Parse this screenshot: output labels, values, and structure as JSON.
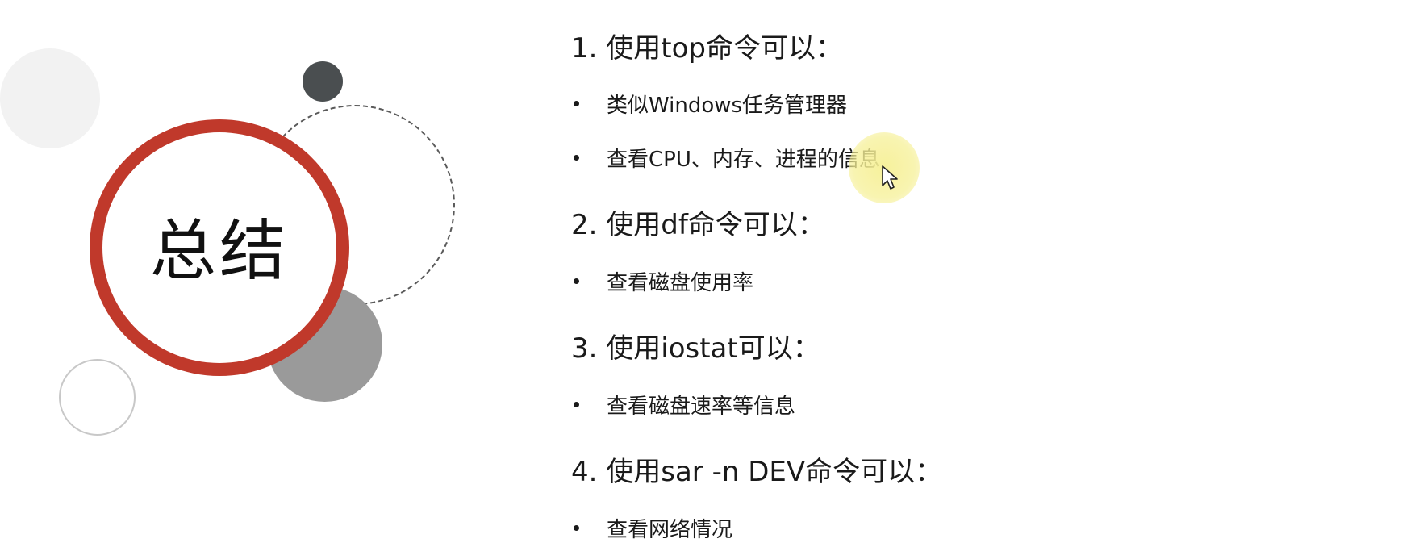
{
  "slide": {
    "title": "总结",
    "sections": [
      {
        "heading": "1. 使用top命令可以：",
        "bullets": [
          "类似Windows任务管理器",
          "查看CPU、内存、进程的信息"
        ]
      },
      {
        "heading": "2. 使用df命令可以：",
        "bullets": [
          "查看磁盘使用率"
        ]
      },
      {
        "heading": "3. 使用iostat可以：",
        "bullets": [
          "查看磁盘速率等信息"
        ]
      },
      {
        "heading": "4. 使用sar -n DEV命令可以：",
        "bullets": [
          "查看网络情况"
        ]
      }
    ]
  },
  "colors": {
    "accent_red": "#c0392b",
    "dark_circle": "#4a4e50",
    "gray_circle": "#9a9a9a",
    "light_circle": "#f2f2f2",
    "cursor_highlight": "#f6f096"
  },
  "icons": {
    "pointer": "mouse-pointer-icon"
  }
}
